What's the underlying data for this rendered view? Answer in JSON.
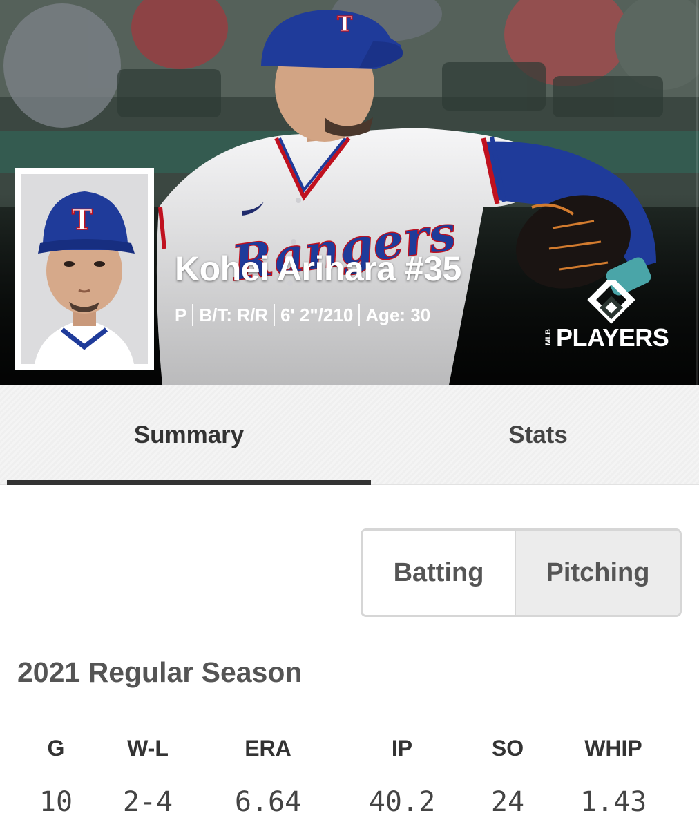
{
  "player": {
    "name": "Kohei Arihara #35",
    "meta": [
      "P",
      "B/T: R/R",
      "6' 2\"/210",
      "Age: 30"
    ]
  },
  "brand": {
    "logo_text": "PLAYERS",
    "logo_small": "MLB"
  },
  "tabs": [
    {
      "label": "Summary",
      "active": true
    },
    {
      "label": "Stats",
      "active": false
    }
  ],
  "stat_toggle": {
    "options": [
      {
        "label": "Batting",
        "selected": false
      },
      {
        "label": "Pitching",
        "selected": true
      }
    ]
  },
  "season": {
    "title": "2021 Regular Season",
    "columns": [
      {
        "head": "G",
        "value": "10"
      },
      {
        "head": "W-L",
        "value": "2-4"
      },
      {
        "head": "ERA",
        "value": "6.64"
      },
      {
        "head": "IP",
        "value": "40.2"
      },
      {
        "head": "SO",
        "value": "24"
      },
      {
        "head": "WHIP",
        "value": "1.43"
      }
    ]
  },
  "colors": {
    "rangers_blue": "#1f3b9a",
    "rangers_red": "#c0111f",
    "tab_underline": "#333333"
  }
}
